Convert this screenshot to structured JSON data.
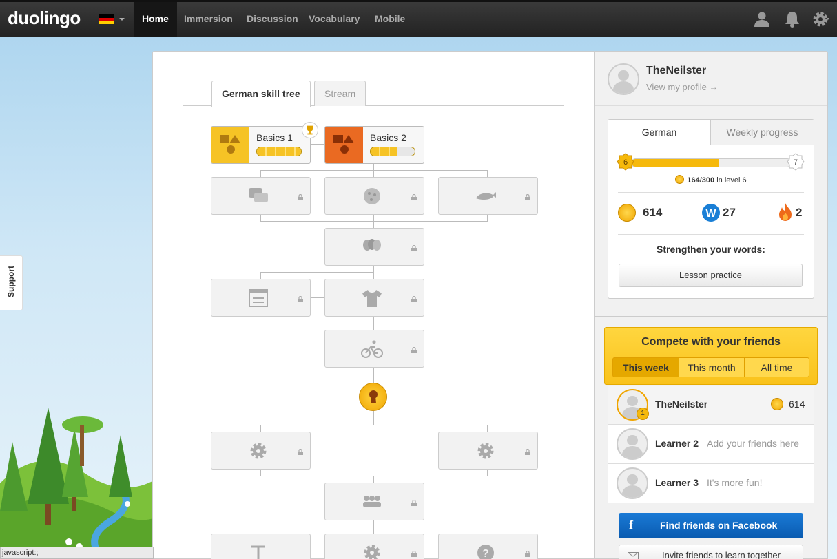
{
  "topbar": {
    "logo": "duolingo",
    "nav": [
      "Home",
      "Immersion",
      "Discussion",
      "Vocabulary",
      "Mobile"
    ],
    "icons": [
      "user-icon",
      "bell-icon",
      "gear-icon"
    ],
    "flag_colors": [
      "#000000",
      "#dd0000",
      "#ffce00"
    ]
  },
  "support": {
    "label": "Support"
  },
  "main": {
    "tabs": [
      "German skill tree",
      "Stream"
    ],
    "skills": [
      {
        "name": "Basics 1",
        "progress": 1.0,
        "color": "#f6c325",
        "trophy": true
      },
      {
        "name": "Basics 2",
        "progress": 0.6,
        "color": "#ea6a22",
        "trophy": false
      }
    ],
    "locked_icons": [
      "chat-bubbles-icon",
      "pizza-icon",
      "whale-icon",
      "balloons-icon",
      "form-icon",
      "shirt-icon",
      "bicycle-icon",
      "gear-icon",
      "gear-icon",
      "people-icon",
      "text-icon",
      "gear-icon",
      "question-icon"
    ]
  },
  "profile": {
    "username": "TheNeilster",
    "view_profile": "View my profile →"
  },
  "progress_card": {
    "tabs": [
      "German",
      "Weekly progress"
    ],
    "level_current": "6",
    "level_next": "7",
    "xp_text_bold": "164/300",
    "xp_text_rest": " in level 6",
    "xp_fraction": 0.547,
    "lingots": "614",
    "words": "27",
    "streak": "2",
    "strengthen": "Strengthen your words:",
    "practice": "Lesson practice"
  },
  "compete": {
    "title": "Compete with your friends",
    "tabs": [
      "This week",
      "This month",
      "All time"
    ],
    "rows": [
      {
        "name": "TheNeilster",
        "rank": "1",
        "score": "614",
        "msg": ""
      },
      {
        "name": "Learner 2",
        "msg": "Add your friends here"
      },
      {
        "name": "Learner 3",
        "msg": "It's more fun!"
      }
    ],
    "facebook": "Find friends on Facebook",
    "invite": "Invite friends to learn together"
  },
  "statusbar": "javascript:;"
}
